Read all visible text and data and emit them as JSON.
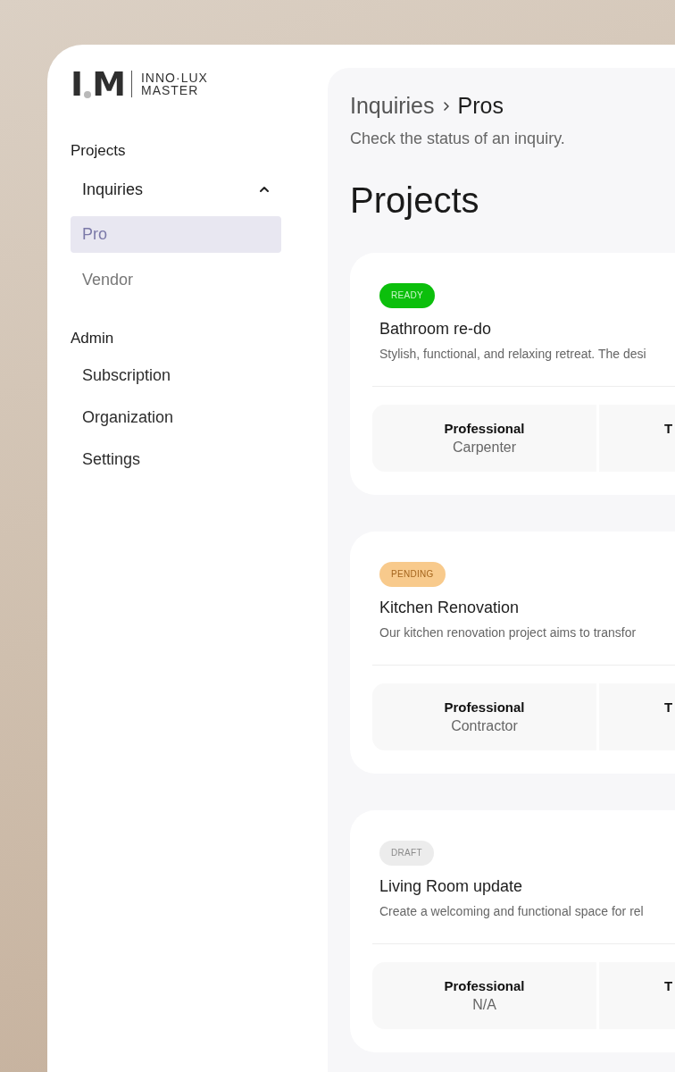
{
  "brand": {
    "mark": [
      "I",
      "M"
    ],
    "line_1": "INNO·LUX",
    "line_2": "MASTER"
  },
  "sidebar": {
    "sections": [
      {
        "title": "Projects",
        "items": [
          {
            "label": "Inquiries",
            "expanded": true,
            "children": [
              {
                "label": "Pro",
                "selected": true
              },
              {
                "label": "Vendor",
                "selected": false
              }
            ]
          }
        ]
      },
      {
        "title": "Admin",
        "items": [
          {
            "label": "Subscription",
            "selected": false
          },
          {
            "label": "Organization",
            "selected": false
          },
          {
            "label": "Settings",
            "selected": false
          }
        ]
      }
    ]
  },
  "breadcrumb": [
    "Inquiries",
    "Pros"
  ],
  "subtitle": "Check the status of an inquiry.",
  "heading": "Projects",
  "projects": [
    {
      "status": {
        "kind": "ready",
        "label": "READY"
      },
      "title": "Bathroom re-do",
      "description": "Stylish, functional, and relaxing retreat. The desi",
      "fields": [
        {
          "label": "Professional",
          "value": "Carpenter"
        },
        {
          "label": "T"
        }
      ]
    },
    {
      "status": {
        "kind": "pending",
        "label": "PENDING"
      },
      "title": "Kitchen Renovation",
      "description": "Our kitchen renovation project aims to transfor",
      "fields": [
        {
          "label": "Professional",
          "value": "Contractor"
        },
        {
          "label": "T"
        }
      ]
    },
    {
      "status": {
        "kind": "draft",
        "label": "DRAFT"
      },
      "title": "Living Room update",
      "description": "Create a welcoming and functional space for rel",
      "fields": [
        {
          "label": "Professional",
          "value": "N/A"
        },
        {
          "label": "T"
        }
      ]
    }
  ]
}
